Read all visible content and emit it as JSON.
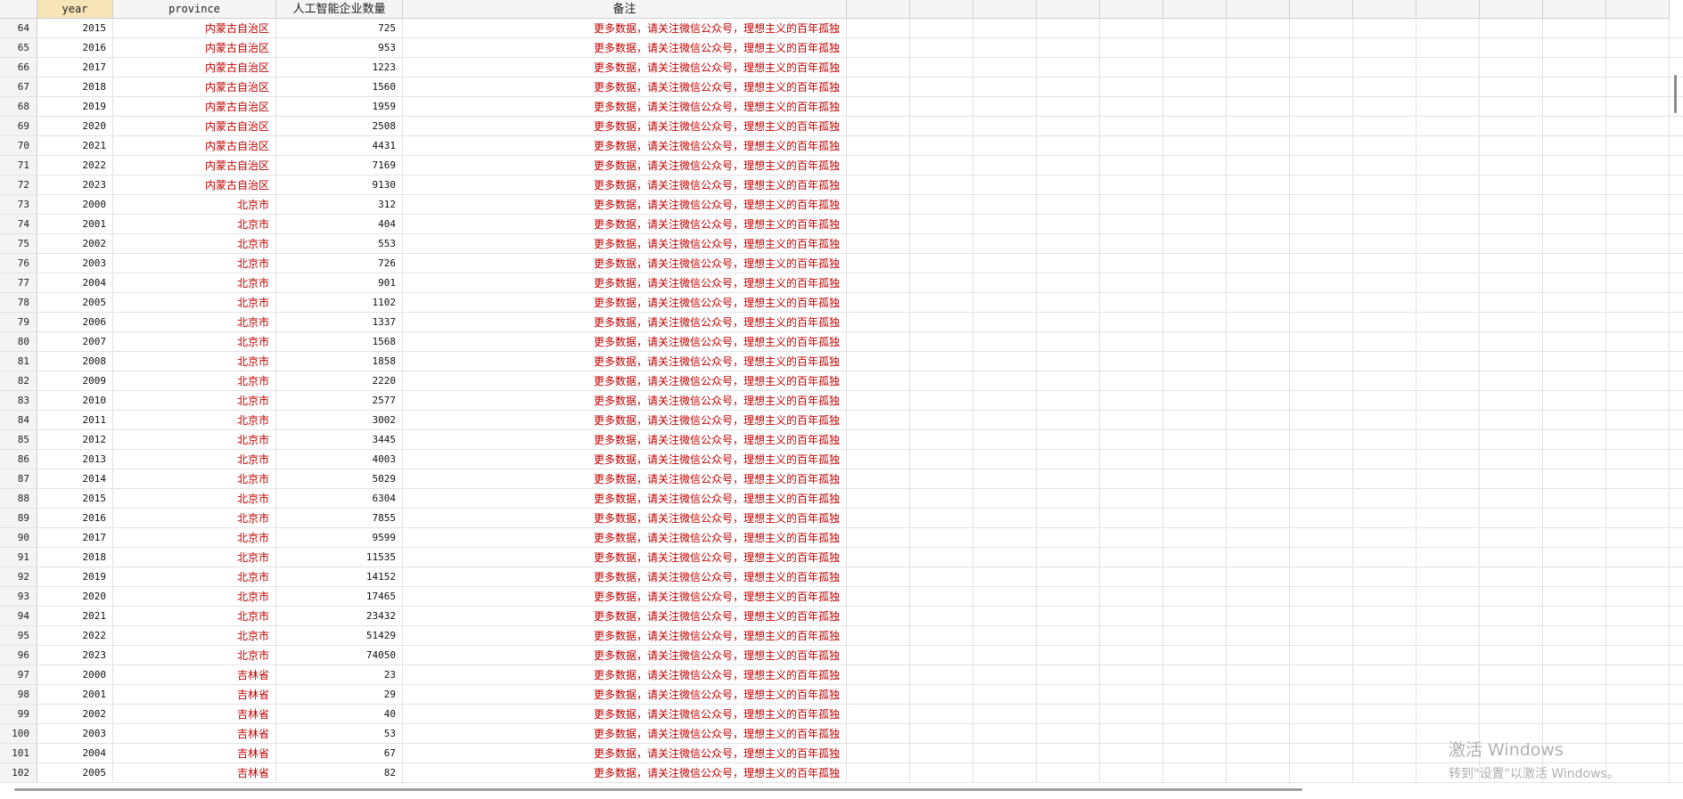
{
  "grid": {
    "columns": [
      "year",
      "province",
      "人工智能企业数量",
      "备注"
    ],
    "active_column": "year",
    "rows": [
      {
        "n": "64",
        "year": "2015",
        "province": "内蒙古自治区",
        "count": "725",
        "note": "更多数据，请关注微信公众号，理想主义的百年孤独"
      },
      {
        "n": "65",
        "year": "2016",
        "province": "内蒙古自治区",
        "count": "953",
        "note": "更多数据，请关注微信公众号，理想主义的百年孤独"
      },
      {
        "n": "66",
        "year": "2017",
        "province": "内蒙古自治区",
        "count": "1223",
        "note": "更多数据，请关注微信公众号，理想主义的百年孤独"
      },
      {
        "n": "67",
        "year": "2018",
        "province": "内蒙古自治区",
        "count": "1560",
        "note": "更多数据，请关注微信公众号，理想主义的百年孤独"
      },
      {
        "n": "68",
        "year": "2019",
        "province": "内蒙古自治区",
        "count": "1959",
        "note": "更多数据，请关注微信公众号，理想主义的百年孤独"
      },
      {
        "n": "69",
        "year": "2020",
        "province": "内蒙古自治区",
        "count": "2508",
        "note": "更多数据，请关注微信公众号，理想主义的百年孤独"
      },
      {
        "n": "70",
        "year": "2021",
        "province": "内蒙古自治区",
        "count": "4431",
        "note": "更多数据，请关注微信公众号，理想主义的百年孤独"
      },
      {
        "n": "71",
        "year": "2022",
        "province": "内蒙古自治区",
        "count": "7169",
        "note": "更多数据，请关注微信公众号，理想主义的百年孤独"
      },
      {
        "n": "72",
        "year": "2023",
        "province": "内蒙古自治区",
        "count": "9130",
        "note": "更多数据，请关注微信公众号，理想主义的百年孤独"
      },
      {
        "n": "73",
        "year": "2000",
        "province": "北京市",
        "count": "312",
        "note": "更多数据，请关注微信公众号，理想主义的百年孤独"
      },
      {
        "n": "74",
        "year": "2001",
        "province": "北京市",
        "count": "404",
        "note": "更多数据，请关注微信公众号，理想主义的百年孤独"
      },
      {
        "n": "75",
        "year": "2002",
        "province": "北京市",
        "count": "553",
        "note": "更多数据，请关注微信公众号，理想主义的百年孤独"
      },
      {
        "n": "76",
        "year": "2003",
        "province": "北京市",
        "count": "726",
        "note": "更多数据，请关注微信公众号，理想主义的百年孤独"
      },
      {
        "n": "77",
        "year": "2004",
        "province": "北京市",
        "count": "901",
        "note": "更多数据，请关注微信公众号，理想主义的百年孤独"
      },
      {
        "n": "78",
        "year": "2005",
        "province": "北京市",
        "count": "1102",
        "note": "更多数据，请关注微信公众号，理想主义的百年孤独"
      },
      {
        "n": "79",
        "year": "2006",
        "province": "北京市",
        "count": "1337",
        "note": "更多数据，请关注微信公众号，理想主义的百年孤独"
      },
      {
        "n": "80",
        "year": "2007",
        "province": "北京市",
        "count": "1568",
        "note": "更多数据，请关注微信公众号，理想主义的百年孤独"
      },
      {
        "n": "81",
        "year": "2008",
        "province": "北京市",
        "count": "1858",
        "note": "更多数据，请关注微信公众号，理想主义的百年孤独"
      },
      {
        "n": "82",
        "year": "2009",
        "province": "北京市",
        "count": "2220",
        "note": "更多数据，请关注微信公众号，理想主义的百年孤独"
      },
      {
        "n": "83",
        "year": "2010",
        "province": "北京市",
        "count": "2577",
        "note": "更多数据，请关注微信公众号，理想主义的百年孤独"
      },
      {
        "n": "84",
        "year": "2011",
        "province": "北京市",
        "count": "3002",
        "note": "更多数据，请关注微信公众号，理想主义的百年孤独"
      },
      {
        "n": "85",
        "year": "2012",
        "province": "北京市",
        "count": "3445",
        "note": "更多数据，请关注微信公众号，理想主义的百年孤独"
      },
      {
        "n": "86",
        "year": "2013",
        "province": "北京市",
        "count": "4003",
        "note": "更多数据，请关注微信公众号，理想主义的百年孤独"
      },
      {
        "n": "87",
        "year": "2014",
        "province": "北京市",
        "count": "5029",
        "note": "更多数据，请关注微信公众号，理想主义的百年孤独"
      },
      {
        "n": "88",
        "year": "2015",
        "province": "北京市",
        "count": "6304",
        "note": "更多数据，请关注微信公众号，理想主义的百年孤独"
      },
      {
        "n": "89",
        "year": "2016",
        "province": "北京市",
        "count": "7855",
        "note": "更多数据，请关注微信公众号，理想主义的百年孤独"
      },
      {
        "n": "90",
        "year": "2017",
        "province": "北京市",
        "count": "9599",
        "note": "更多数据，请关注微信公众号，理想主义的百年孤独"
      },
      {
        "n": "91",
        "year": "2018",
        "province": "北京市",
        "count": "11535",
        "note": "更多数据，请关注微信公众号，理想主义的百年孤独"
      },
      {
        "n": "92",
        "year": "2019",
        "province": "北京市",
        "count": "14152",
        "note": "更多数据，请关注微信公众号，理想主义的百年孤独"
      },
      {
        "n": "93",
        "year": "2020",
        "province": "北京市",
        "count": "17465",
        "note": "更多数据，请关注微信公众号，理想主义的百年孤独"
      },
      {
        "n": "94",
        "year": "2021",
        "province": "北京市",
        "count": "23432",
        "note": "更多数据，请关注微信公众号，理想主义的百年孤独"
      },
      {
        "n": "95",
        "year": "2022",
        "province": "北京市",
        "count": "51429",
        "note": "更多数据，请关注微信公众号，理想主义的百年孤独"
      },
      {
        "n": "96",
        "year": "2023",
        "province": "北京市",
        "count": "74050",
        "note": "更多数据，请关注微信公众号，理想主义的百年孤独"
      },
      {
        "n": "97",
        "year": "2000",
        "province": "吉林省",
        "count": "23",
        "note": "更多数据，请关注微信公众号，理想主义的百年孤独"
      },
      {
        "n": "98",
        "year": "2001",
        "province": "吉林省",
        "count": "29",
        "note": "更多数据，请关注微信公众号，理想主义的百年孤独"
      },
      {
        "n": "99",
        "year": "2002",
        "province": "吉林省",
        "count": "40",
        "note": "更多数据，请关注微信公众号，理想主义的百年孤独"
      },
      {
        "n": "100",
        "year": "2003",
        "province": "吉林省",
        "count": "53",
        "note": "更多数据，请关注微信公众号，理想主义的百年孤独"
      },
      {
        "n": "101",
        "year": "2004",
        "province": "吉林省",
        "count": "67",
        "note": "更多数据，请关注微信公众号，理想主义的百年孤独"
      },
      {
        "n": "102",
        "year": "2005",
        "province": "吉林省",
        "count": "82",
        "note": "更多数据，请关注微信公众号，理想主义的百年孤独"
      }
    ]
  },
  "watermark": {
    "title": "激活 Windows",
    "subtitle": "转到\"设置\"以激活 Windows。"
  },
  "colors": {
    "string_text": "#c00000",
    "active_header": "#f7e5b8"
  }
}
